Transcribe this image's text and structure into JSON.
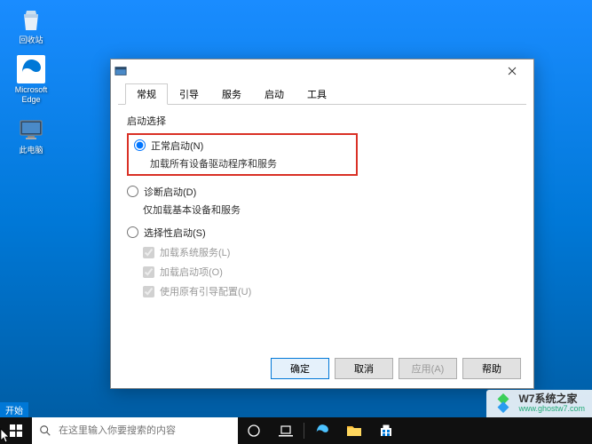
{
  "desktop": {
    "icons": [
      {
        "id": "recycle-bin",
        "label": "回收站"
      },
      {
        "id": "edge",
        "label": "Microsoft Edge"
      },
      {
        "id": "this-pc",
        "label": "此电脑"
      }
    ]
  },
  "window": {
    "tabs": [
      "常规",
      "引导",
      "服务",
      "启动",
      "工具"
    ],
    "active_tab": 0,
    "section_title": "启动选择",
    "radios": {
      "normal": {
        "label": "正常启动(N)",
        "sub": "加载所有设备驱动程序和服务",
        "checked": true
      },
      "diagnostic": {
        "label": "诊断启动(D)",
        "sub": "仅加载基本设备和服务",
        "checked": false
      },
      "selective": {
        "label": "选择性启动(S)",
        "checked": false,
        "options": [
          {
            "label": "加载系统服务(L)",
            "checked": true,
            "disabled": true
          },
          {
            "label": "加载启动项(O)",
            "checked": true,
            "disabled": true
          },
          {
            "label": "使用原有引导配置(U)",
            "checked": true,
            "disabled": true
          }
        ]
      }
    },
    "buttons": {
      "ok": "确定",
      "cancel": "取消",
      "apply": "应用(A)",
      "help": "帮助"
    }
  },
  "taskbar": {
    "start_tooltip": "开始",
    "search_placeholder": "在这里输入你要搜索的内容"
  },
  "watermark": {
    "title": "W7系统之家",
    "url": "www.ghostw7.com"
  }
}
